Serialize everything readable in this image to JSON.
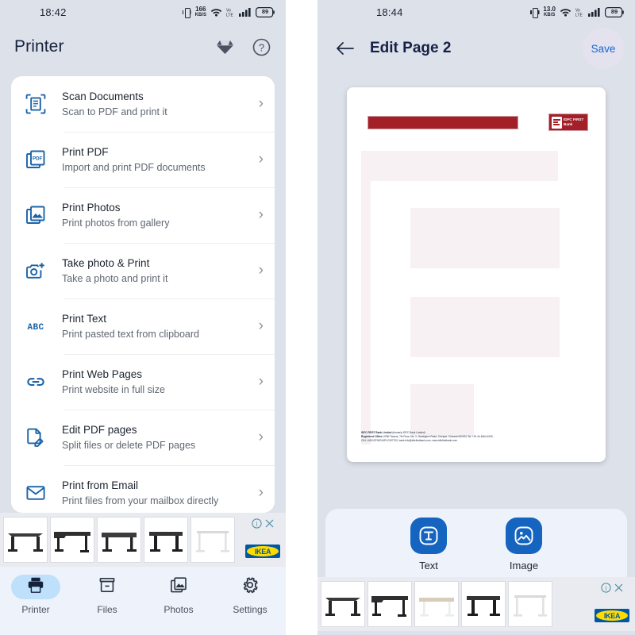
{
  "left": {
    "status": {
      "time": "18:42",
      "net_speed_value": "166",
      "net_speed_unit": "KB/S",
      "battery": "89",
      "icons": [
        "vibrate-icon",
        "network-speed-icon",
        "wifi-icon",
        "sim-signal-icon",
        "cellular-signal-icon",
        "battery-icon"
      ]
    },
    "appbar": {
      "title": "Printer",
      "premium_icon": "diamond-icon",
      "help_icon": "help-circle-icon"
    },
    "menu": [
      {
        "icon": "scan-document-icon",
        "title": "Scan Documents",
        "subtitle": "Scan to PDF and print it"
      },
      {
        "icon": "pdf-file-icon",
        "title": "Print PDF",
        "subtitle": "Import and print PDF documents"
      },
      {
        "icon": "photo-stack-icon",
        "title": "Print Photos",
        "subtitle": "Print photos from gallery"
      },
      {
        "icon": "camera-plus-icon",
        "title": "Take photo & Print",
        "subtitle": "Take a photo and print it"
      },
      {
        "icon": "abc-text-icon",
        "title": "Print Text",
        "subtitle": "Print pasted text from clipboard"
      },
      {
        "icon": "link-chain-icon",
        "title": "Print Web Pages",
        "subtitle": "Print website in full size"
      },
      {
        "icon": "edit-document-icon",
        "title": "Edit PDF pages",
        "subtitle": "Split files or delete PDF pages"
      },
      {
        "icon": "email-envelope-icon",
        "title": "Print from Email",
        "subtitle": "Print files from your mailbox directly"
      }
    ],
    "chevron": "›",
    "ad": {
      "advertiser": "IKEA",
      "info_icon": "info-icon",
      "close_icon": "close-icon",
      "thumbs": [
        "desk-dark-corner",
        "desk-dark-left",
        "desk-dark-straight",
        "desk-dark-sit-stand",
        "desk-white-frame"
      ]
    },
    "bottomnav": [
      {
        "icon": "printer-icon",
        "label": "Printer",
        "active": true
      },
      {
        "icon": "files-box-icon",
        "label": "Files",
        "active": false
      },
      {
        "icon": "photos-icon",
        "label": "Photos",
        "active": false
      },
      {
        "icon": "settings-gear-icon",
        "label": "Settings",
        "active": false
      }
    ]
  },
  "right": {
    "status": {
      "time": "18:44",
      "net_speed_value": "13.0",
      "net_speed_unit": "KB/S",
      "battery": "89"
    },
    "topbar": {
      "back_icon": "back-arrow-icon",
      "title": "Edit Page 2",
      "save_label": "Save"
    },
    "document": {
      "brand_line1": "IDFC FIRST",
      "brand_line2": "Bank",
      "footer_line1_bold": "IDFC FIRST Bank Limited",
      "footer_line1_rest": " (formerly IDFC Bank Limited)",
      "footer_line2_bold": "Registered Office:",
      "footer_line2_rest": " KRM Towers, 7th Floor, No. 1, Harrington Road, Chetpet, Chennai 600031 Tel: +91 44 4564 4000,",
      "footer_line3": "CIN: L65110TN2014PLC097792, bank.info@idfcfirstbank.com, www.idfcfirstbank.com"
    },
    "tools": [
      {
        "icon": "text-tool-icon",
        "label": "Text"
      },
      {
        "icon": "image-tool-icon",
        "label": "Image"
      }
    ],
    "ad": {
      "advertiser": "IKEA",
      "info_icon": "info-icon",
      "close_icon": "close-icon",
      "thumbs": [
        "desk-dark-corner",
        "desk-dark-left",
        "desk-light-wood",
        "desk-dark-straight",
        "desk-white-frame"
      ]
    }
  },
  "colors": {
    "accent_blue": "#1565c0",
    "icon_blue": "#1b63a8",
    "phone_bg": "#dde1ea",
    "nav_bg": "#eef2fb",
    "active_pill": "#bfe0fb",
    "brand_red": "#a32029",
    "save_text": "#1968d2"
  }
}
